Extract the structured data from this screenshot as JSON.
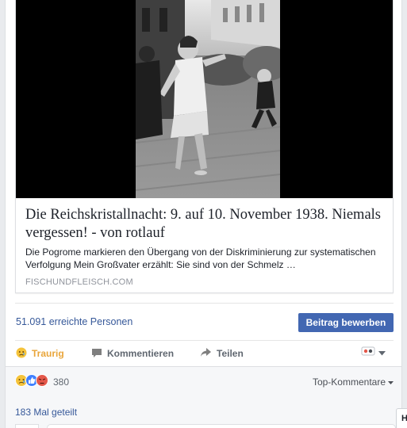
{
  "preview": {
    "title": "Die Reichskristallnacht: 9. auf 10. November 1938. Niemals vergessen! - von rotlauf",
    "description": "Die Pogrome markieren den Übergang von der Diskriminierung zur systematischen Verfolgung Mein Großvater erzählt: Sie sind von der Schmelz …",
    "domain": "FISCHUNDFLEISCH.COM"
  },
  "reach": {
    "text": "51.091 erreichte Personen",
    "boost_label": "Beitrag bewerben"
  },
  "actions": {
    "reaction_label": "Traurig",
    "comment_label": "Kommentieren",
    "share_label": "Teilen"
  },
  "summary": {
    "reaction_count": "380",
    "sort_label": "Top-Kommentare",
    "shares_text": "183 Mal geteilt"
  },
  "side_tab": {
    "label": "H"
  },
  "colors": {
    "link": "#365899",
    "button": "#4267b2",
    "sad": "#e9a53a",
    "like": "#4080ff",
    "angry": "#e4574a"
  },
  "icons": {
    "sad_reaction": "sad-face-icon",
    "comment": "speech-bubble-icon",
    "share": "share-arrow-icon",
    "audience": "audience-face-icon",
    "dropdown": "caret-down-icon",
    "reactions": [
      "sad-face-icon",
      "like-icon",
      "angry-face-icon"
    ]
  }
}
